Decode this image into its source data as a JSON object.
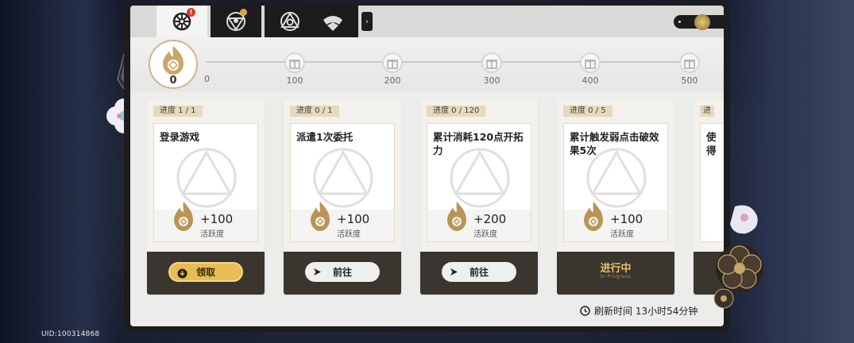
{
  "uid": "UID:100314868",
  "tabs": [
    {
      "name": "daily-training",
      "active": true,
      "badge": "!"
    },
    {
      "name": "nameless-honor",
      "active": false,
      "badge": "dot"
    },
    {
      "name": "tab-3",
      "active": false
    },
    {
      "name": "tab-4",
      "active": false
    }
  ],
  "activity": {
    "current": "0",
    "start_label": "0",
    "milestones": [
      "100",
      "200",
      "300",
      "400",
      "500"
    ]
  },
  "cards": [
    {
      "progress": "进度  1 / 1",
      "title": "登录游戏",
      "points": "+100",
      "unit": "活跃度",
      "action": "领取",
      "state": "claim"
    },
    {
      "progress": "进度  0 / 1",
      "title": "派遣1次委托",
      "points": "+100",
      "unit": "活跃度",
      "action": "前往",
      "state": "go"
    },
    {
      "progress": "进度  0 / 120",
      "title": "累计消耗120点开拓力",
      "points": "+200",
      "unit": "活跃度",
      "action": "前往",
      "state": "go"
    },
    {
      "progress": "进度  0 / 5",
      "title": "累计触发弱点击破效果5次",
      "points": "+100",
      "unit": "活跃度",
      "action": "进行中",
      "state": "in-progress",
      "action_sub": "In Progress"
    },
    {
      "progress": "进",
      "title": "使\n得",
      "state": "partial"
    }
  ],
  "refresh": "刷新时间 13小时54分钟",
  "colors": {
    "accent_gold": "#e7bd54",
    "card_dark": "#3a352e",
    "badge_red": "#d43b2a"
  }
}
